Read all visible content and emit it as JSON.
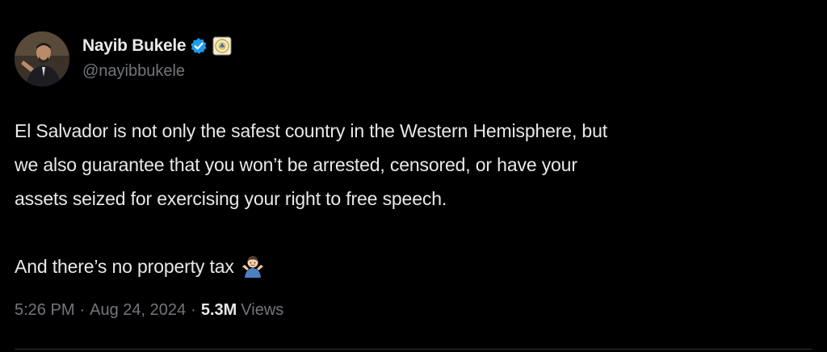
{
  "author": {
    "display_name": "Nayib Bukele",
    "handle": "@nayibbukele",
    "verified_badge_color": "#1d9bf0",
    "verified_icon": "verified-badge-icon",
    "affiliation_icon": "government-seal-icon"
  },
  "tweet": {
    "lines": [
      "El Salvador is not only the safest country in the Western Hemisphere, but",
      "we also guarantee that you won’t be arrested, censored, or have your",
      "assets seized for exercising your right to free speech."
    ],
    "last_line": "And there’s no property tax",
    "last_line_emoji": "person-shrugging-emoji"
  },
  "meta": {
    "time": "5:26 PM",
    "separator": "·",
    "date": "Aug 24, 2024",
    "views_count": "5.3M",
    "views_label": "Views"
  },
  "colors": {
    "background": "#000000",
    "primary_text": "#e7e9ea",
    "secondary_text": "#71767b",
    "divider": "#2f3336"
  }
}
